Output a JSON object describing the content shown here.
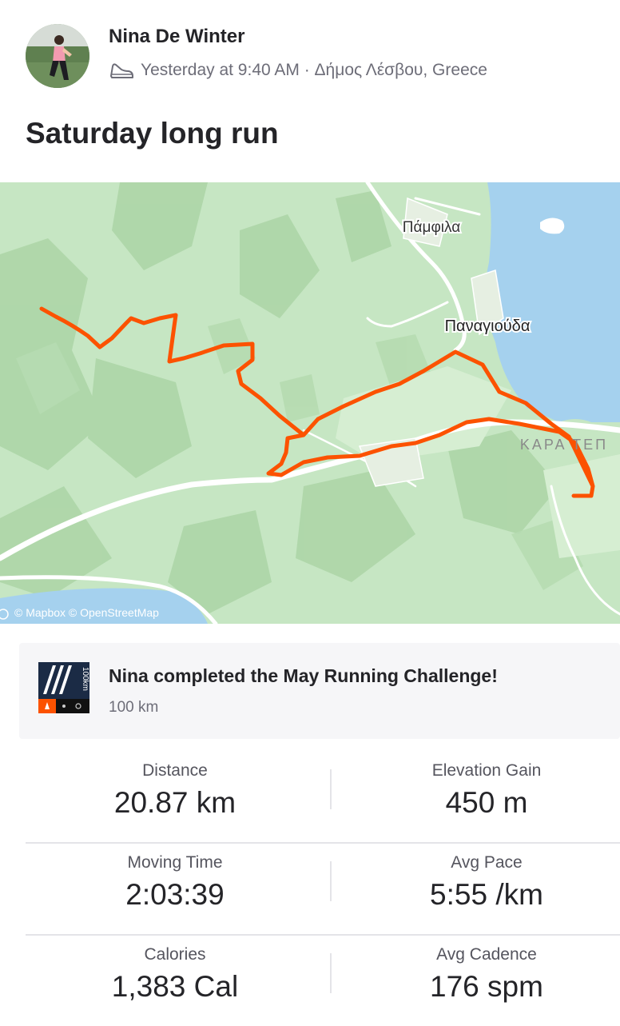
{
  "athlete": {
    "name": "Nina De Winter",
    "timestamp": "Yesterday at 9:40 AM · Δήμος Λέσβου, Greece",
    "activity_icon": "shoe-icon"
  },
  "activity": {
    "title": "Saturday long run"
  },
  "map": {
    "labels": {
      "village1": "Πάμφιλα",
      "village2": "Παναγιούδα",
      "village3": "ΚΑΡΑ ΤΕΠ"
    },
    "attribution": "© Mapbox © OpenStreetMap",
    "route_color": "#fc5200",
    "water_color": "#a5d1ee",
    "land_color": "#c6e6c3"
  },
  "challenge": {
    "title": "Nina completed the May Running Challenge!",
    "subtitle": "100 km",
    "badge_text": "100km"
  },
  "stats": [
    {
      "left": {
        "label": "Distance",
        "value": "20.87 km"
      },
      "right": {
        "label": "Elevation Gain",
        "value": "450 m"
      }
    },
    {
      "left": {
        "label": "Moving Time",
        "value": "2:03:39"
      },
      "right": {
        "label": "Avg Pace",
        "value": "5:55 /km"
      }
    },
    {
      "left": {
        "label": "Calories",
        "value": "1,383 Cal"
      },
      "right": {
        "label": "Avg Cadence",
        "value": "176 spm"
      }
    }
  ]
}
